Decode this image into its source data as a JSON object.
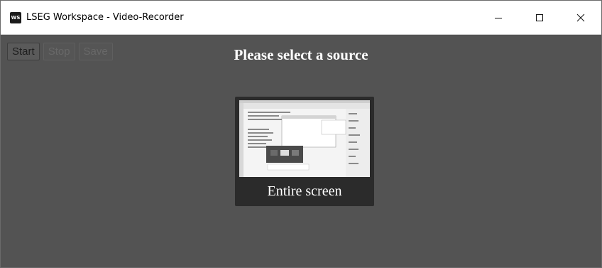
{
  "window": {
    "icon_text": "WS",
    "title": "LSEG Workspace - Video-Recorder",
    "minimize_symbol": "—",
    "maximize_symbol": "☐",
    "close_symbol": "✕"
  },
  "toolbar": {
    "start_label": "Start",
    "stop_label": "Stop",
    "save_label": "Save"
  },
  "main": {
    "heading": "Please select a source"
  },
  "sources": [
    {
      "label": "Entire screen"
    }
  ],
  "colors": {
    "background": "#535353",
    "card": "#2b2b2b",
    "titlebar": "#ffffff"
  }
}
